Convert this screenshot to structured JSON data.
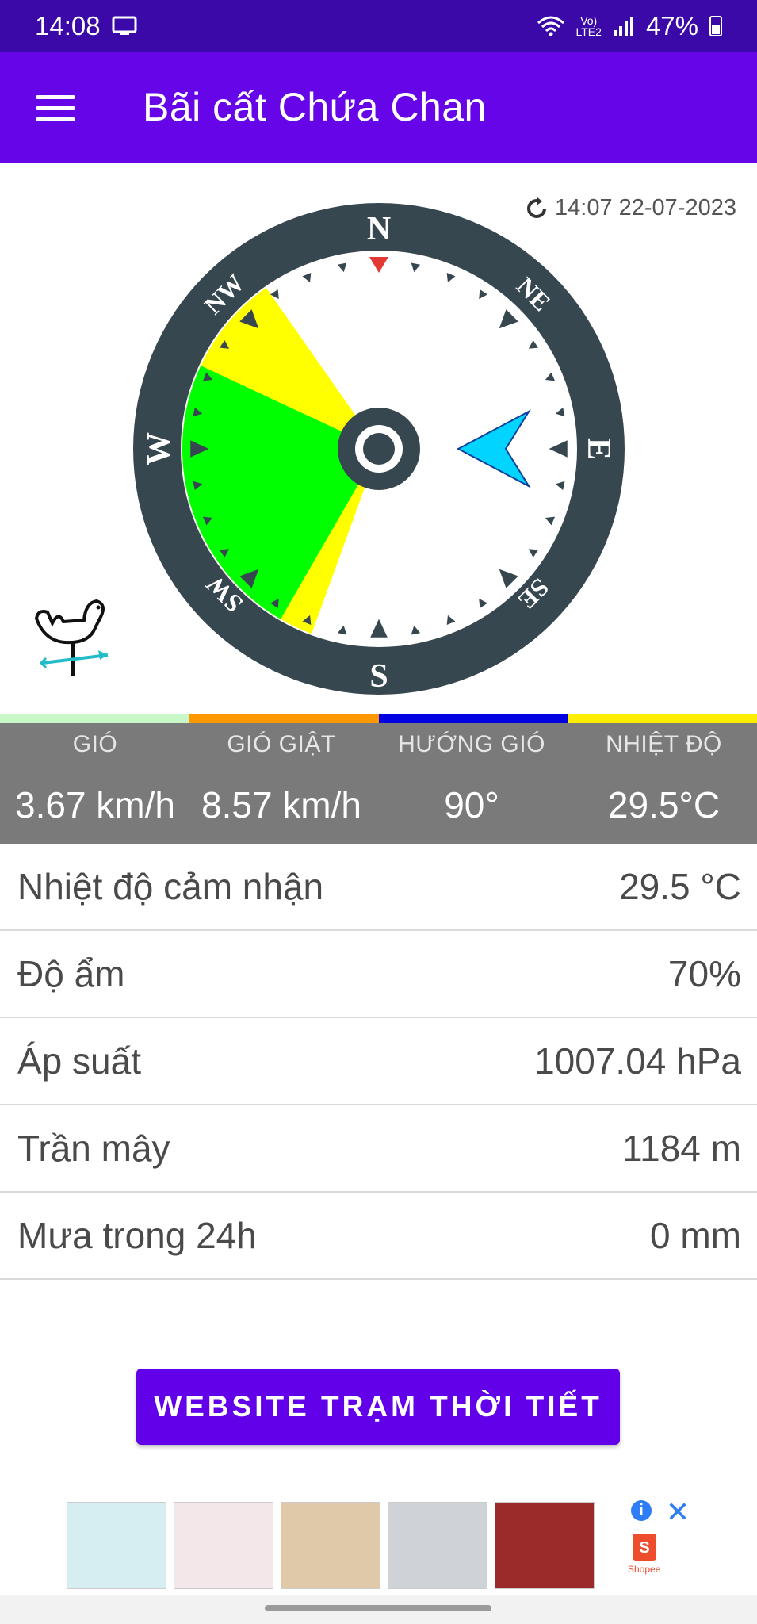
{
  "status_bar": {
    "time": "14:08",
    "network_top": "Vo)",
    "network_bottom": "LTE2",
    "battery": "47%"
  },
  "app_bar": {
    "title": "Bãi cất Chứa Chan"
  },
  "compass": {
    "updated": "14:07 22-07-2023",
    "cardinals": {
      "n": "N",
      "e": "E",
      "s": "S",
      "w": "W"
    },
    "intercardinals": {
      "ne": "NE",
      "se": "SE",
      "sw": "SW",
      "nw": "NW"
    },
    "wind_direction_deg": 90,
    "zones": [
      {
        "color": "#ffff00",
        "from_deg": 200,
        "to_deg": 325
      },
      {
        "color": "#00ff00",
        "from_deg": 210,
        "to_deg": 295
      }
    ],
    "colors": {
      "ring": "#37474f",
      "arrow": "#00d4ff",
      "north_marker": "#e53935"
    }
  },
  "strip_colors": [
    "#c8f7c8",
    "#ff9800",
    "#0000e0",
    "#ffee00"
  ],
  "summary": [
    {
      "label": "GIÓ",
      "value": "3.67 km/h"
    },
    {
      "label": "GIÓ GIẬT",
      "value": "8.57 km/h"
    },
    {
      "label": "HƯỚNG GIÓ",
      "value": "90°"
    },
    {
      "label": "NHIỆT ĐỘ",
      "value": "29.5°C"
    }
  ],
  "details": [
    {
      "label": "Nhiệt độ cảm nhận",
      "value": "29.5 °C"
    },
    {
      "label": "Độ ẩm",
      "value": "70%"
    },
    {
      "label": "Áp suất",
      "value": "1007.04 hPa"
    },
    {
      "label": "Trần mây",
      "value": "1184 m"
    },
    {
      "label": "Mưa trong 24h",
      "value": "0 mm"
    }
  ],
  "website_button": "WEBSITE TRẠM THỜI TIẾT",
  "ad": {
    "info": "i",
    "close": "✕",
    "brand_letter": "S",
    "brand": "Shopee",
    "thumb_colors": [
      "#d6eef2",
      "#f4e7e9",
      "#e0c9a8",
      "#cfd2d6",
      "#9b2a2a"
    ]
  }
}
